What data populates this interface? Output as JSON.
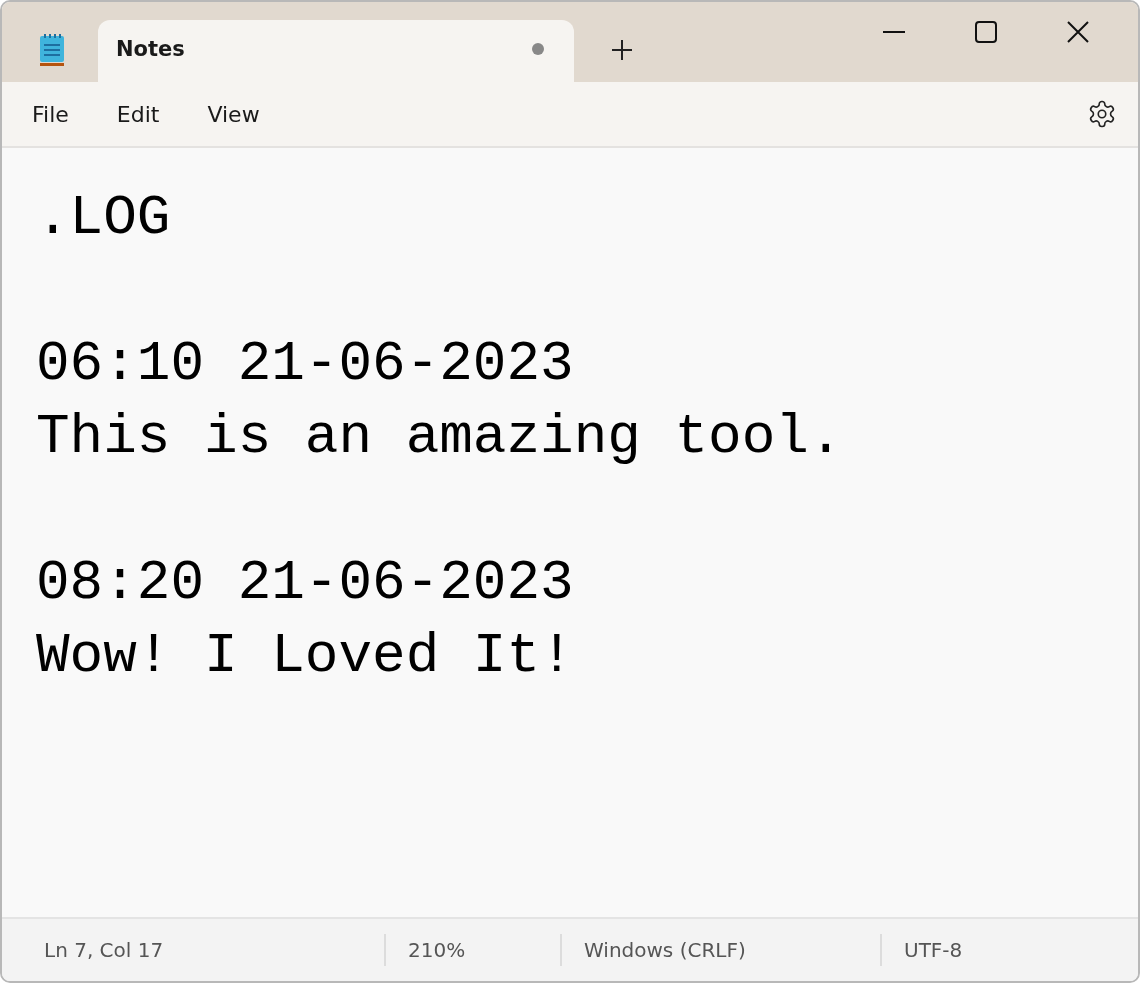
{
  "tabs": [
    {
      "title": "Notes",
      "selected": true,
      "modified": true
    }
  ],
  "menu": [
    "File",
    "Edit",
    "View"
  ],
  "editor": {
    "text": ".LOG\n\n06:10 21-06-2023\nThis is an amazing tool.\n\n08:20 21-06-2023\nWow! I Loved It!"
  },
  "status_bar": [
    "Ln 7, Col 17",
    "210%",
    "Windows (CRLF)",
    "UTF-8"
  ]
}
